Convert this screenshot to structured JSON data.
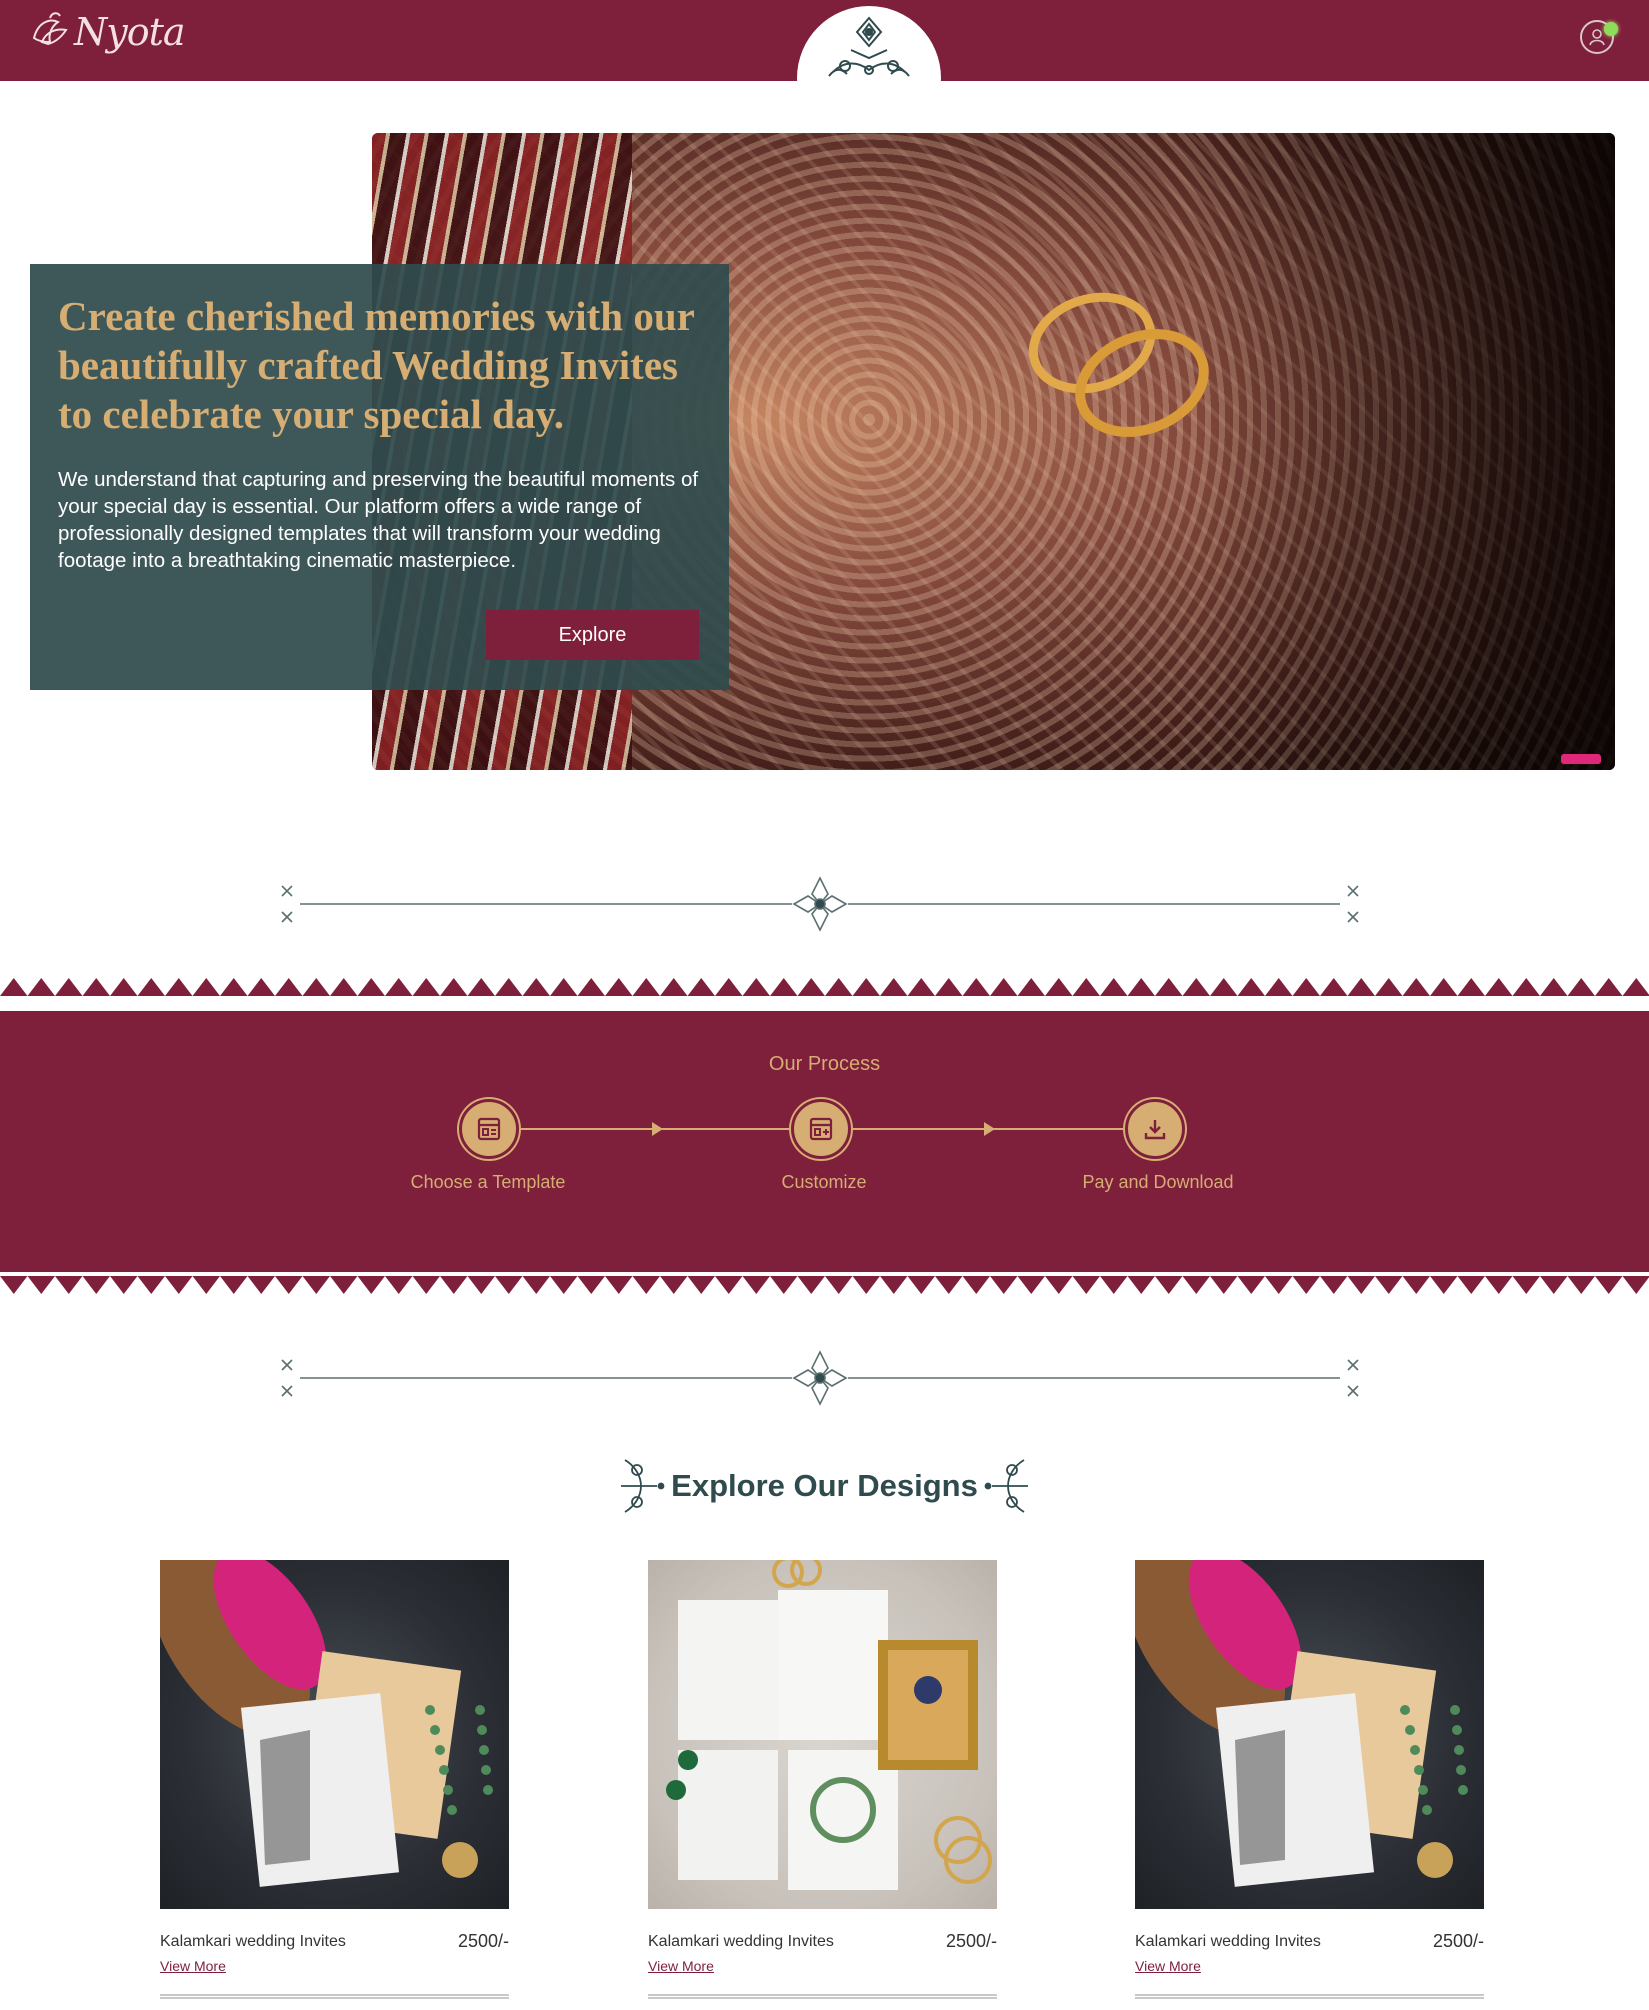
{
  "header": {
    "logo_text": "Nyota",
    "background_color": "#7e1f3b"
  },
  "hero": {
    "title": "Create cherished memories with our beautifully crafted Wedding Invites to celebrate your special day.",
    "description": "We understand that capturing and preserving the beautiful moments of your special day is essential. Our platform offers a wide range of professionally designed templates that will transform your wedding footage into a breathtaking cinematic masterpiece.",
    "explore_label": "Explore",
    "card_color": "#2f4b4d",
    "title_color": "#d6ad73"
  },
  "process": {
    "title": "Our Process",
    "steps": [
      {
        "label": "Choose a Template",
        "icon": "template-icon"
      },
      {
        "label": "Customize",
        "icon": "customize-icon"
      },
      {
        "label": "Pay and Download",
        "icon": "download-icon"
      }
    ]
  },
  "designs": {
    "heading": "Explore Our Designs",
    "cards": [
      {
        "title": "Kalamkari wedding Invites",
        "price": "2500/-",
        "link": "View More"
      },
      {
        "title": "Kalamkari wedding Invites",
        "price": "2500/-",
        "link": "View More"
      },
      {
        "title": "Kalamkari wedding Invites",
        "price": "2500/-",
        "link": "View More"
      }
    ]
  },
  "colors": {
    "brand": "#7e1f3b",
    "gold": "#d6ad73",
    "teal": "#2f4b4d",
    "status_online": "#8fdc59"
  }
}
